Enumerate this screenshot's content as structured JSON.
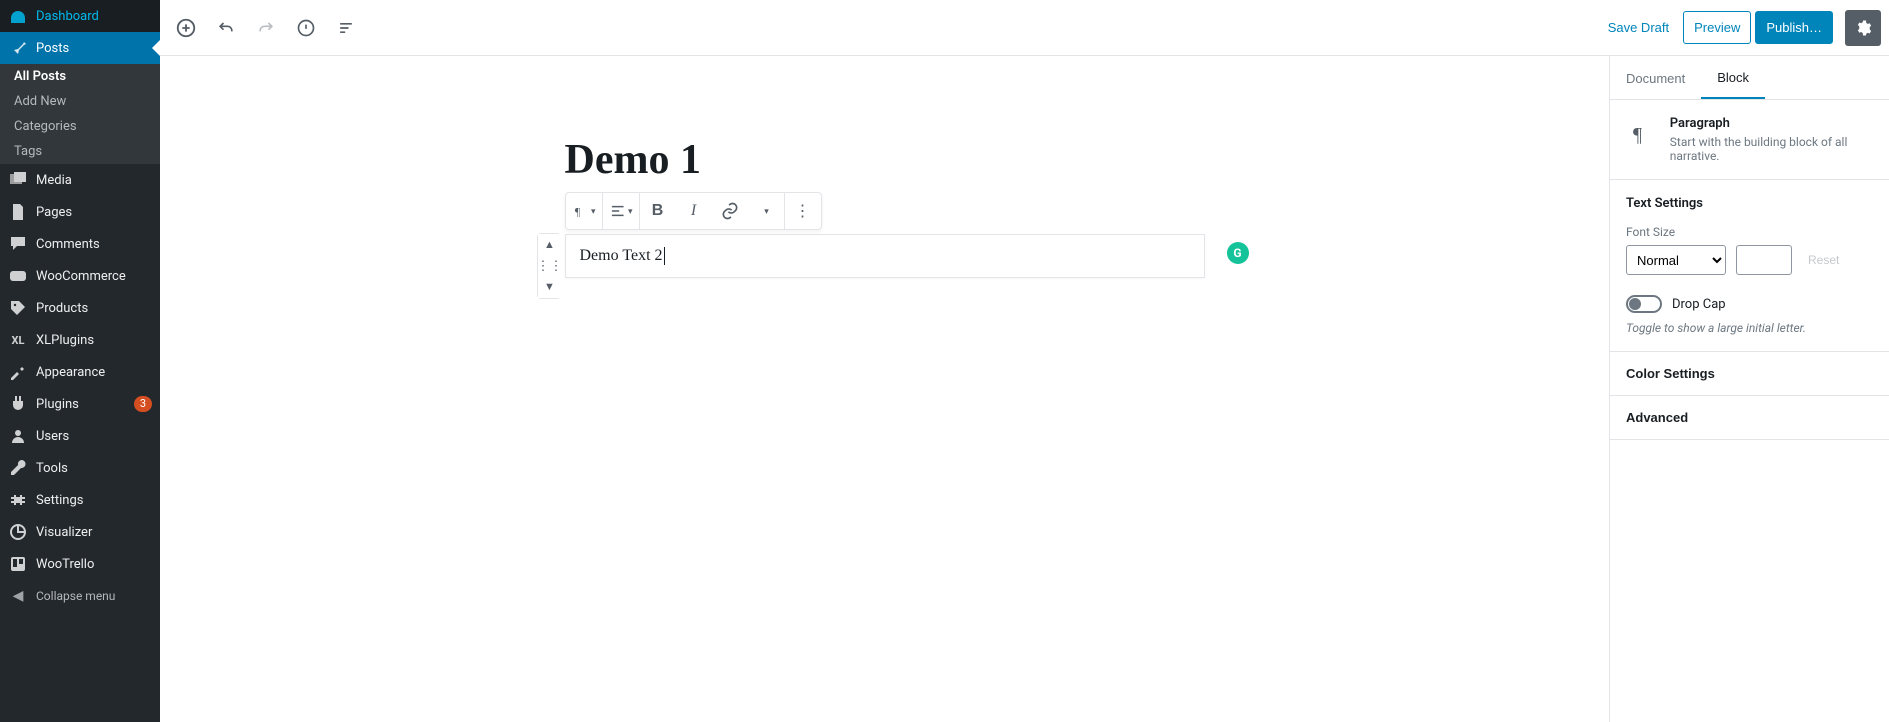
{
  "sidebar": {
    "items": [
      {
        "id": "dashboard",
        "label": "Dashboard",
        "icon": "dashboard-icon"
      },
      {
        "id": "posts",
        "label": "Posts",
        "icon": "pin-icon",
        "active": true,
        "children": [
          {
            "id": "all-posts",
            "label": "All Posts",
            "current": true
          },
          {
            "id": "add-new",
            "label": "Add New"
          },
          {
            "id": "categories",
            "label": "Categories"
          },
          {
            "id": "tags",
            "label": "Tags"
          }
        ]
      },
      {
        "id": "media",
        "label": "Media",
        "icon": "media-icon"
      },
      {
        "id": "pages",
        "label": "Pages",
        "icon": "pages-icon"
      },
      {
        "id": "comments",
        "label": "Comments",
        "icon": "comments-icon"
      },
      {
        "id": "woocommerce",
        "label": "WooCommerce",
        "icon": "woo-icon"
      },
      {
        "id": "products",
        "label": "Products",
        "icon": "products-icon"
      },
      {
        "id": "xlplugins",
        "label": "XLPlugins",
        "icon": "xl-icon"
      },
      {
        "id": "appearance",
        "label": "Appearance",
        "icon": "appearance-icon"
      },
      {
        "id": "plugins",
        "label": "Plugins",
        "icon": "plugins-icon",
        "badge": "3"
      },
      {
        "id": "users",
        "label": "Users",
        "icon": "users-icon"
      },
      {
        "id": "tools",
        "label": "Tools",
        "icon": "tools-icon"
      },
      {
        "id": "settings",
        "label": "Settings",
        "icon": "settings-icon"
      },
      {
        "id": "visualizer",
        "label": "Visualizer",
        "icon": "visualizer-icon"
      },
      {
        "id": "wootrello",
        "label": "WooTrello",
        "icon": "wootrello-icon"
      }
    ],
    "collapse_label": "Collapse menu"
  },
  "topbar": {
    "save_draft": "Save Draft",
    "preview": "Preview",
    "publish": "Publish…"
  },
  "editor": {
    "title": "Demo 1",
    "paragraph_text": "Demo Text 2"
  },
  "inspector": {
    "tabs": {
      "document": "Document",
      "block": "Block"
    },
    "block_card": {
      "name": "Paragraph",
      "desc": "Start with the building block of all narrative."
    },
    "text_settings": {
      "heading": "Text Settings",
      "font_size_label": "Font Size",
      "font_size_value": "Normal",
      "custom_size_value": "",
      "reset_label": "Reset",
      "drop_cap_label": "Drop Cap",
      "drop_cap_on": false,
      "drop_cap_hint": "Toggle to show a large initial letter."
    },
    "color_settings_label": "Color Settings",
    "advanced_label": "Advanced"
  }
}
